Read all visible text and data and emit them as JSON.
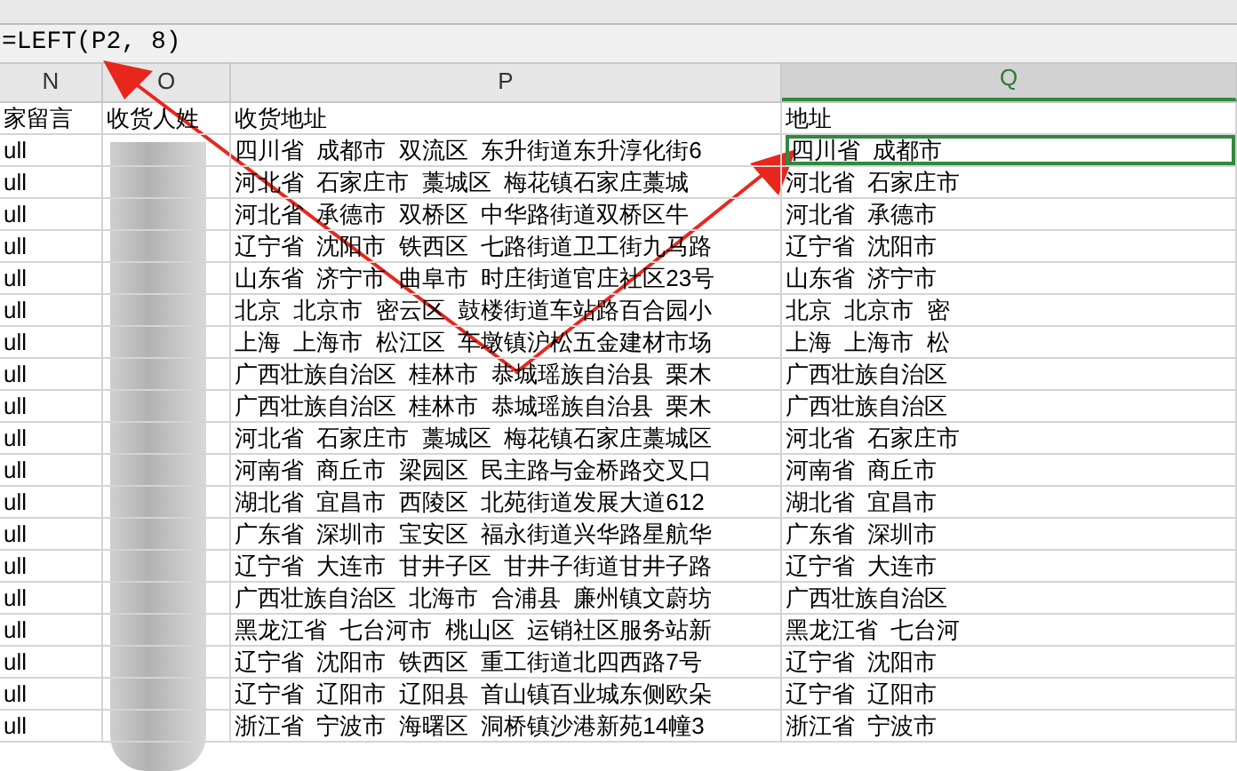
{
  "formula_bar": {
    "formula": "=LEFT(P2, 8)"
  },
  "columns": [
    {
      "letter": "N",
      "selected": false
    },
    {
      "letter": "O",
      "selected": false
    },
    {
      "letter": "P",
      "selected": false
    },
    {
      "letter": "Q",
      "selected": true
    }
  ],
  "header_row": {
    "n": "家留言",
    "o": "收货人姓",
    "p": "收货地址",
    "q": "地址"
  },
  "rows": [
    {
      "n": "ull",
      "p": "四川省  成都市  双流区  东升街道东升淳化街6",
      "q": "四川省  成都市",
      "selected": true
    },
    {
      "n": "ull",
      "p": "河北省  石家庄市  藁城区  梅花镇石家庄藁城",
      "q": "河北省  石家庄市",
      "selected": false
    },
    {
      "n": "ull",
      "p": "河北省  承德市  双桥区  中华路街道双桥区牛",
      "q": "河北省  承德市",
      "selected": false
    },
    {
      "n": "ull",
      "p": "辽宁省  沈阳市  铁西区  七路街道卫工街九马路",
      "q": "辽宁省  沈阳市",
      "selected": false
    },
    {
      "n": "ull",
      "p": "山东省  济宁市  曲阜市  时庄街道官庄社区23号",
      "q": "山东省  济宁市",
      "selected": false
    },
    {
      "n": "ull",
      "p": "北京  北京市  密云区  鼓楼街道车站路百合园小",
      "q": "北京  北京市  密",
      "selected": false
    },
    {
      "n": "ull",
      "p": "上海  上海市  松江区  车墩镇沪松五金建材市场",
      "q": "上海  上海市  松",
      "selected": false
    },
    {
      "n": "ull",
      "p": "广西壮族自治区  桂林市  恭城瑶族自治县  栗木",
      "q": "广西壮族自治区",
      "selected": false
    },
    {
      "n": "ull",
      "p": "广西壮族自治区  桂林市  恭城瑶族自治县  栗木",
      "q": "广西壮族自治区",
      "selected": false
    },
    {
      "n": "ull",
      "p": "河北省  石家庄市  藁城区  梅花镇石家庄藁城区",
      "q": "河北省  石家庄市",
      "selected": false
    },
    {
      "n": "ull",
      "p": "河南省  商丘市  梁园区  民主路与金桥路交叉口",
      "q": "河南省  商丘市",
      "selected": false
    },
    {
      "n": "ull",
      "p": "湖北省  宜昌市  西陵区  北苑街道发展大道612",
      "q": "湖北省  宜昌市",
      "selected": false
    },
    {
      "n": "ull",
      "p": "广东省  深圳市  宝安区  福永街道兴华路星航华",
      "q": "广东省  深圳市",
      "selected": false
    },
    {
      "n": "ull",
      "p": "辽宁省  大连市  甘井子区  甘井子街道甘井子路",
      "q": "辽宁省  大连市",
      "selected": false
    },
    {
      "n": "ull",
      "p": "广西壮族自治区  北海市  合浦县  廉州镇文蔚坊",
      "q": "广西壮族自治区",
      "selected": false
    },
    {
      "n": "ull",
      "p": "黑龙江省  七台河市  桃山区  运销社区服务站新",
      "q": "黑龙江省  七台河",
      "selected": false
    },
    {
      "n": "ull",
      "p": "辽宁省  沈阳市  铁西区  重工街道北四西路7号",
      "q": "辽宁省  沈阳市",
      "selected": false
    },
    {
      "n": "ull",
      "p": "辽宁省  辽阳市  辽阳县  首山镇百业城东侧欧朵",
      "q": "辽宁省  辽阳市",
      "selected": false
    },
    {
      "n": "ull",
      "p": "浙江省  宁波市  海曙区  洞桥镇沙港新苑14幢3",
      "q": "浙江省  宁波市",
      "selected": false
    }
  ]
}
